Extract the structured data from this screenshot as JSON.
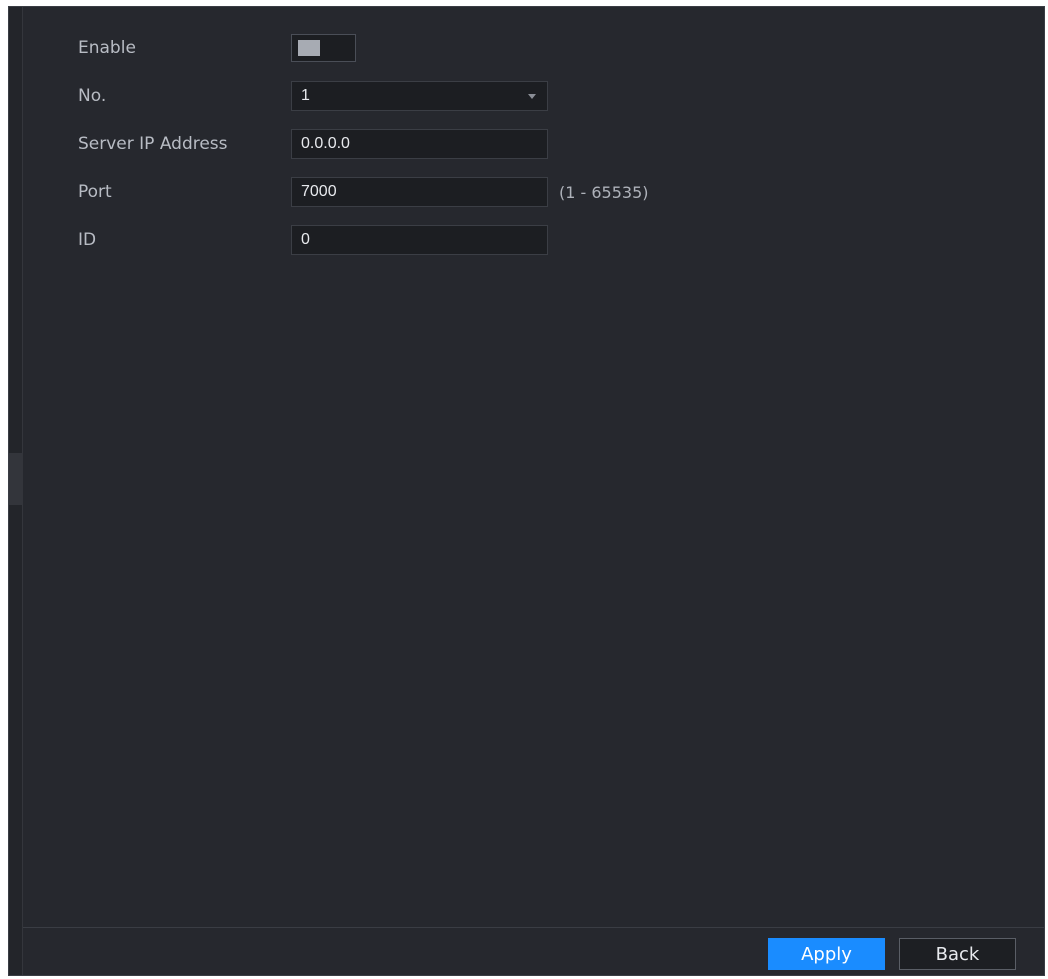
{
  "form": {
    "enable": {
      "label": "Enable",
      "value": false
    },
    "number": {
      "label": "No.",
      "value": "1"
    },
    "server_ip": {
      "label": "Server IP Address",
      "value": "0.0.0.0"
    },
    "port": {
      "label": "Port",
      "value": "7000",
      "hint": "(1 - 65535)"
    },
    "id": {
      "label": "ID",
      "value": "0"
    }
  },
  "footer": {
    "apply_label": "Apply",
    "back_label": "Back"
  },
  "colors": {
    "background": "#26282e",
    "field": "#1c1e22",
    "accent": "#1a8cff",
    "label_text": "#b8bcc4"
  },
  "icons": {
    "dropdown": "chevron-down-icon"
  }
}
